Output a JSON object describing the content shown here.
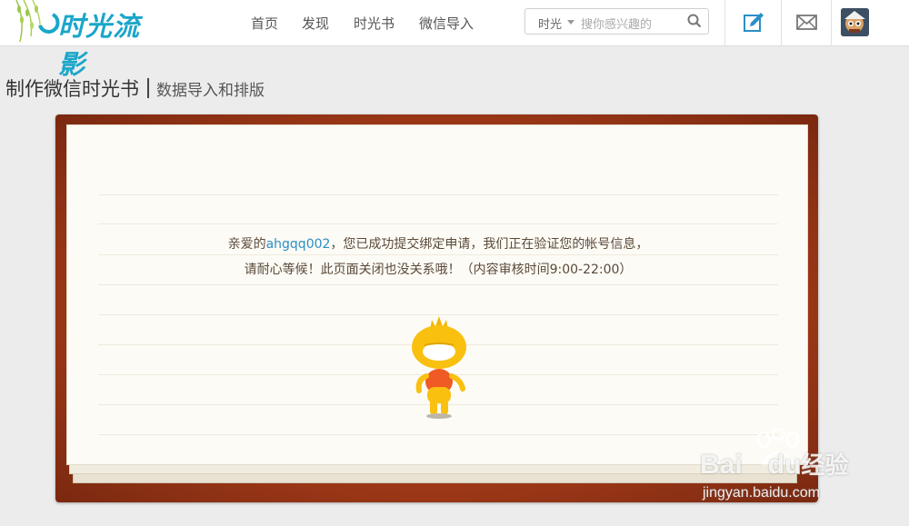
{
  "header": {
    "logo_text": "时光流影",
    "nav": [
      "首页",
      "发现",
      "时光书",
      "微信导入"
    ],
    "search": {
      "scope": "时光",
      "placeholder": "搜你感兴趣的"
    }
  },
  "page": {
    "title": "制作微信时光书",
    "subtitle": "数据导入和排版"
  },
  "notice": {
    "greeting": "亲爱的",
    "username": "ahgqq002",
    "line1_rest": "，您已成功提交绑定申请，我们正在验证您的帐号信息，",
    "line2": "请耐心等候！此页面关闭也没关系哦！（内容审核时间9:00-22:00）"
  },
  "watermark": {
    "brand": "Bai",
    "brand2": "du",
    "brand_cn": "经验",
    "site": "jingyan.baidu.com"
  },
  "colors": {
    "accent": "#1aa6c9",
    "link": "#2a8fc7",
    "frame": "#a13a18"
  }
}
